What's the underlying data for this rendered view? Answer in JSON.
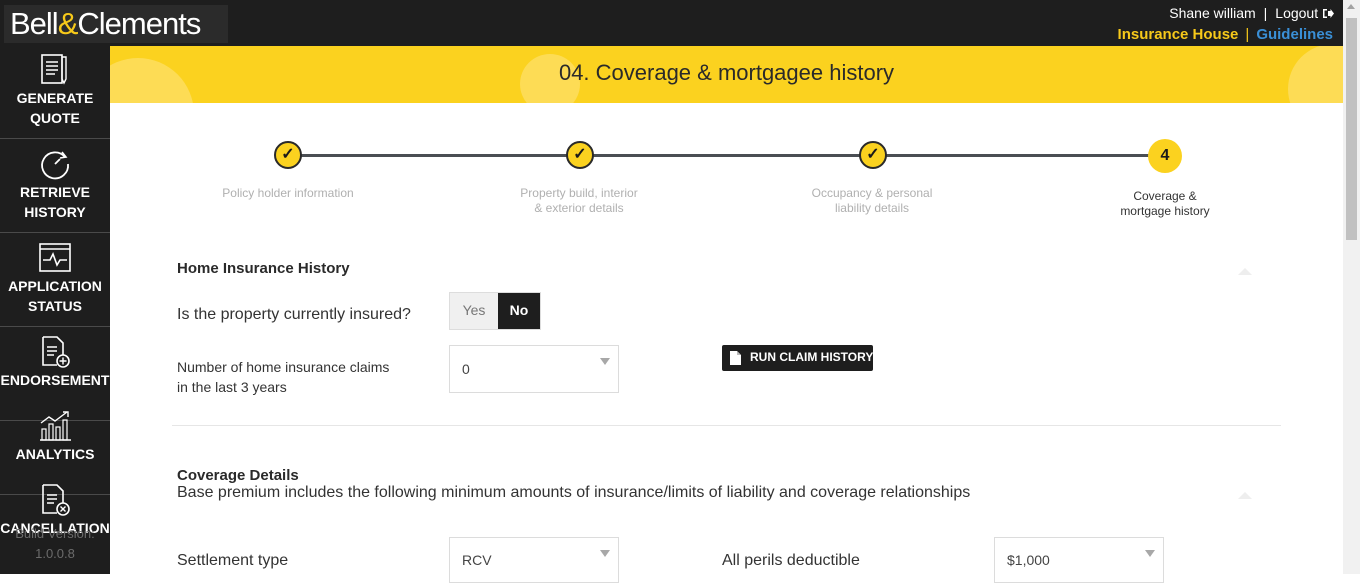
{
  "brand": {
    "name_part1": "Bell",
    "amp": "&",
    "name_part2": "Clements"
  },
  "header": {
    "user_name": "Shane william",
    "separator": "|",
    "logout_label": "Logout",
    "insurance_house_label": "Insurance House",
    "guidelines_label": "Guidelines"
  },
  "sidebar": {
    "items": [
      {
        "label": "GENERATE QUOTE",
        "icon": "document-list-icon"
      },
      {
        "label": "RETRIEVE HISTORY",
        "icon": "history-clock-icon"
      },
      {
        "label": "APPLICATION STATUS",
        "icon": "status-pulse-icon"
      },
      {
        "label": "ENDORSEMENT",
        "icon": "document-add-icon"
      },
      {
        "label": "ANALYTICS",
        "icon": "bar-chart-trend-icon"
      },
      {
        "label": "CANCELLATION",
        "icon": "document-cancel-icon"
      }
    ],
    "build_label": "Build Version:",
    "build_version": "1.0.0.8"
  },
  "page": {
    "title": "04. Coverage & mortgagee history"
  },
  "stepper": {
    "steps": [
      {
        "label": "Policy holder information",
        "state": "done"
      },
      {
        "label_line1": "Property build, interior",
        "label_line2": "& exterior details",
        "state": "done"
      },
      {
        "label_line1": "Occupancy & personal",
        "label_line2": "liability details",
        "state": "done"
      },
      {
        "number": "4",
        "label_line1": "Coverage &",
        "label_line2": "mortgage history",
        "state": "current"
      }
    ],
    "check_glyph": "✓"
  },
  "home_insurance_history": {
    "title": "Home Insurance History",
    "insured_question": "Is the property currently insured?",
    "insured_options": [
      "Yes",
      "No"
    ],
    "insured_selected": "No",
    "claims_label_line1": "Number of home insurance claims",
    "claims_label_line2": "in the last 3 years",
    "claims_value": "0",
    "run_claim_history_label": "RUN CLAIM HISTORY"
  },
  "coverage_details": {
    "title": "Coverage Details",
    "description": "Base premium includes the following minimum amounts of insurance/limits of liability and coverage relationships",
    "settlement_type_label": "Settlement type",
    "settlement_type_value": "RCV",
    "all_perils_label": "All perils deductible",
    "all_perils_value": "$1,000"
  },
  "colors": {
    "accent_yellow": "#fbd21f",
    "dark": "#1e1e1e",
    "link_blue": "#3a8fd6"
  }
}
